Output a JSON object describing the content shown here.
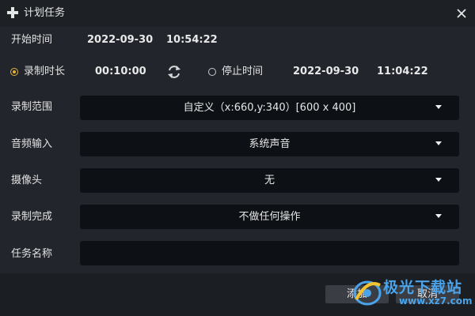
{
  "window": {
    "title": "计划任务",
    "icon": "plus-icon",
    "close_icon": "close-icon"
  },
  "start": {
    "label": "开始时间",
    "date": "2022-09-30",
    "time": "10:54:22"
  },
  "mode": {
    "duration_label": "录制时长",
    "duration_selected": true,
    "duration_value": "00:10:00",
    "swap_icon": "swap-arrows-icon",
    "stop_label": "停止时间",
    "stop_selected": false,
    "stop_date": "2022-09-30",
    "stop_time": "11:04:22"
  },
  "fields": {
    "range": {
      "label": "录制范围",
      "value": "自定义（x:660,y:340）[600 x 400]"
    },
    "audio": {
      "label": "音频输入",
      "value": "系统声音"
    },
    "camera": {
      "label": "摄像头",
      "value": "无"
    },
    "finish": {
      "label": "录制完成",
      "value": "不做任何操作"
    },
    "task_name": {
      "label": "任务名称",
      "value": ""
    }
  },
  "buttons": {
    "add": "添加",
    "cancel": "取消"
  },
  "watermark": {
    "brand": "极光下载站",
    "url": "www.xz7.com"
  },
  "colors": {
    "accent": "#e4b23c",
    "field_bg": "#0d1115",
    "dialog_bg": "#22262c",
    "watermark": "#4ba3ea"
  }
}
